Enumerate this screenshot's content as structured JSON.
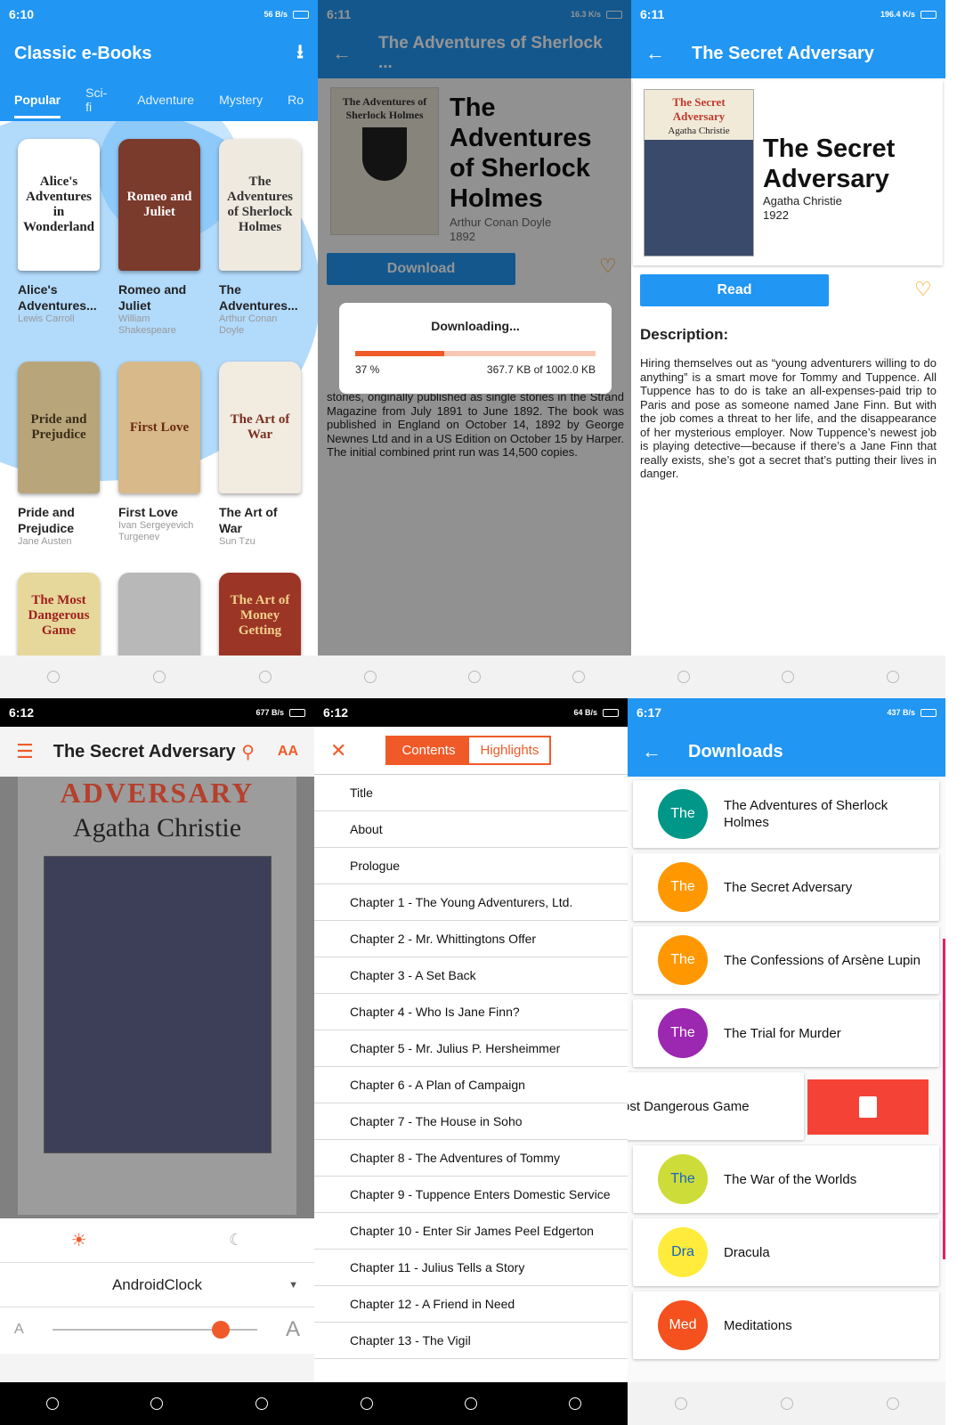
{
  "panel1": {
    "time": "6:10",
    "net": "56 B/s",
    "title": "Classic e-Books",
    "tabs": [
      "Popular",
      "Sci-fi",
      "Adventure",
      "Mystery",
      "Ro"
    ],
    "books": [
      {
        "title": "Alice's Adventures...",
        "author": "Lewis Carroll",
        "cover": "Alice's Adventures in Wonderland",
        "bg": "#ffffff",
        "fg": "#222222"
      },
      {
        "title": "Romeo and Juliet",
        "author": "William Shakespeare",
        "cover": "Romeo and Juliet",
        "bg": "#7a3a2c",
        "fg": "#ffffff"
      },
      {
        "title": "The Adventures...",
        "author": "Arthur Conan Doyle",
        "cover": "The Adventures of Sherlock Holmes",
        "bg": "#efeae0",
        "fg": "#333333"
      },
      {
        "title": "Pride and Prejudice",
        "author": "Jane Austen",
        "cover": "Pride and Prejudice",
        "bg": "#b9a57a",
        "fg": "#3a2e1a"
      },
      {
        "title": "First Love",
        "author": "Ivan Sergeyevich Turgenev",
        "cover": "First Love",
        "bg": "#d7b98a",
        "fg": "#6b2a10"
      },
      {
        "title": "The Art of War",
        "author": "Sun Tzu",
        "cover": "The Art of War",
        "bg": "#f2ebe0",
        "fg": "#7a3020"
      },
      {
        "title": "",
        "author": "",
        "cover": "The Most Dangerous Game",
        "bg": "#e6d89a",
        "fg": "#a02020"
      },
      {
        "title": "",
        "author": "",
        "cover": "",
        "bg": "#b8b8b8",
        "fg": "#222222"
      },
      {
        "title": "",
        "author": "",
        "cover": "The Art of Money Getting",
        "bg": "#9b3526",
        "fg": "#f2d08a"
      }
    ]
  },
  "panel2": {
    "time": "6:11",
    "net": "16.3 K/s",
    "title": "The Adventures of Sherlock ...",
    "book_title": "The Adventures of Sherlock Holmes",
    "author": "Arthur Conan Doyle",
    "year": "1892",
    "download_label": "Download",
    "dialog_title": "Downloading...",
    "progress": 0.37,
    "progress_pct": "37 %",
    "progress_size": "367.7 KB of 1002.0 KB",
    "desc": "stories, originally published as single stories in the Strand Magazine from July 1891 to June 1892. The book was published in England on October 14, 1892 by George Newnes Ltd and in a US Edition on October 15 by Harper. The initial combined print run was 14,500 copies."
  },
  "panel3": {
    "time": "6:11",
    "net": "196.4 K/s",
    "title": "The Secret Adversary",
    "book_title": "The Secret Adversary",
    "author": "Agatha Christie",
    "year": "1922",
    "read_label": "Read",
    "desc_heading": "Description:",
    "desc": "Hiring themselves out as “young adventurers willing to do anything” is a smart move for Tommy and Tuppence. All Tuppence has to do is take an all-expenses-paid trip to Paris and pose as someone named Jane Finn. But with the job comes a threat to her life, and the disappearance of her mysterious employer. Now Tuppence’s newest job is playing detective—because if there’s a Jane Finn that really exists, she’s got a secret that’s putting their lives in danger."
  },
  "panel4": {
    "time": "6:12",
    "net": "677 B/s",
    "title": "The Secret Adversary",
    "cover_line1": "ADVERSARY",
    "cover_line2": "Agatha Christie",
    "font_name": "AndroidClock",
    "font_size": 0.82
  },
  "panel5": {
    "time": "6:12",
    "net": "64 B/s",
    "tab_contents": "Contents",
    "tab_highlights": "Highlights",
    "toc": [
      "Title",
      "About",
      "Prologue",
      "Chapter 1 - The Young Adventurers, Ltd.",
      "Chapter 2 - Mr. Whittingtons Offer",
      "Chapter 3 - A Set Back",
      "Chapter 4 - Who Is Jane Finn?",
      "Chapter 5 - Mr. Julius P. Hersheimmer",
      "Chapter 6 - A Plan of Campaign",
      "Chapter 7 - The House in Soho",
      "Chapter 8 - The Adventures of Tommy",
      "Chapter 9 - Tuppence Enters Domestic Service",
      "Chapter 10 - Enter Sir James Peel Edgerton",
      "Chapter 11 - Julius Tells a Story",
      "Chapter 12 - A Friend in Need",
      "Chapter 13 - The Vigil"
    ]
  },
  "panel6": {
    "time": "6:17",
    "net": "437 B/s",
    "title": "Downloads",
    "items": [
      {
        "abbr": "The",
        "title": "The Adventures of Sherlock Holmes",
        "color": "#009688"
      },
      {
        "abbr": "The",
        "title": "The Secret Adversary",
        "color": "#ff9800"
      },
      {
        "abbr": "The",
        "title": "The Confessions of Arsène Lupin",
        "color": "#ff9800"
      },
      {
        "abbr": "The",
        "title": "The Trial for Murder",
        "color": "#9c27b0"
      },
      {
        "abbr": "",
        "title": "ost Dangerous Game",
        "color": ""
      },
      {
        "abbr": "The",
        "title": "The War of the Worlds",
        "color": "#cddc39"
      },
      {
        "abbr": "Dra",
        "title": "Dracula",
        "color": "#ffeb3b"
      },
      {
        "abbr": "Med",
        "title": "Meditations",
        "color": "#f4511e"
      }
    ]
  },
  "colors": {
    "primary": "#2196f3",
    "accent": "#f05a28",
    "heart": "#ff9800",
    "delete": "#f44336"
  }
}
